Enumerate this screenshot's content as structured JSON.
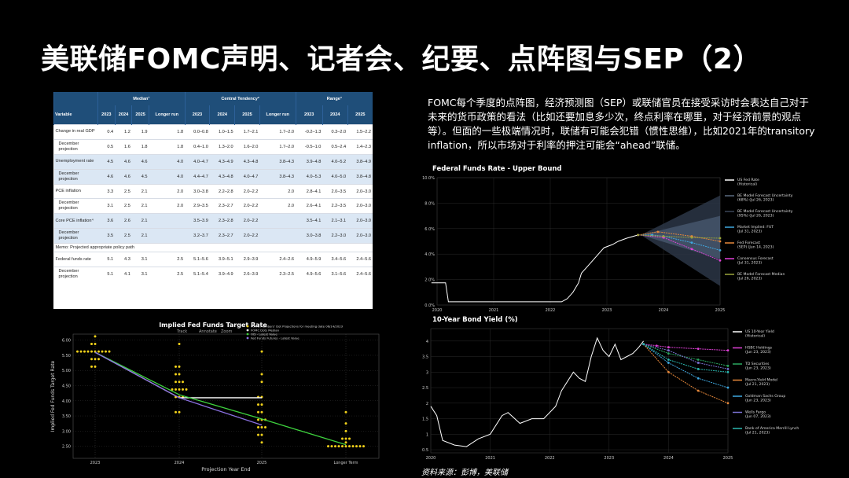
{
  "slide": {
    "title": "美联储FOMC声明、记者会、纪要、点阵图与SEP（2）",
    "commentary": "FOMC每个季度的点阵图，经济预测图（SEP）或联储官员在接受采访时会表达自己对于未来的货币政策的看法（比如还要加息多少次，终点利率在哪里，对于经济前景的观点等）。但面的一些极端情况时，联储有可能会犯错（惯性思维），比如2021年的transitory inflation，所以市场对于利率的押注可能会“ahead”联储。",
    "source": "资料来源：彭博，美联储"
  },
  "sep_table": {
    "variable_header": "Variable",
    "groups": [
      "Median¹",
      "Central Tendency²",
      "Range³"
    ],
    "col_headers": [
      "2023",
      "2024",
      "2025",
      "Longer run",
      "2023",
      "2024",
      "2025",
      "Longer run",
      "2023",
      "2024",
      "2025"
    ],
    "memo": "Memo: Projected appropriate policy path",
    "rows": [
      {
        "label": "Change in real GDP",
        "indent": false,
        "shade": false,
        "cells": [
          "0.4",
          "1.2",
          "1.9",
          "1.8",
          "0.0–0.8",
          "1.0–1.5",
          "1.7–2.1",
          "1.7–2.0",
          "-0.2–1.3",
          "0.3–2.0",
          "1.5–2.2"
        ]
      },
      {
        "label": "December projection",
        "indent": true,
        "shade": false,
        "cells": [
          "0.5",
          "1.6",
          "1.8",
          "1.8",
          "0.4–1.0",
          "1.3–2.0",
          "1.6–2.0",
          "1.7–2.0",
          "-0.5–1.0",
          "0.5–2.4",
          "1.4–2.3"
        ]
      },
      {
        "label": "Unemployment rate",
        "indent": false,
        "shade": true,
        "cells": [
          "4.5",
          "4.6",
          "4.6",
          "4.0",
          "4.0–4.7",
          "4.3–4.9",
          "4.3–4.8",
          "3.8–4.3",
          "3.9–4.8",
          "4.0–5.2",
          "3.8–4.9"
        ]
      },
      {
        "label": "December projection",
        "indent": true,
        "shade": true,
        "cells": [
          "4.6",
          "4.6",
          "4.5",
          "4.0",
          "4.4–4.7",
          "4.3–4.8",
          "4.0–4.7",
          "3.8–4.3",
          "4.0–5.3",
          "4.0–5.0",
          "3.8–4.8"
        ]
      },
      {
        "label": "PCE inflation",
        "indent": false,
        "shade": false,
        "cells": [
          "3.3",
          "2.5",
          "2.1",
          "2.0",
          "3.0–3.8",
          "2.2–2.8",
          "2.0–2.2",
          "2.0",
          "2.8–4.1",
          "2.0–3.5",
          "2.0–3.0"
        ]
      },
      {
        "label": "December projection",
        "indent": true,
        "shade": false,
        "cells": [
          "3.1",
          "2.5",
          "2.1",
          "2.0",
          "2.9–3.5",
          "2.3–2.7",
          "2.0–2.2",
          "2.0",
          "2.6–4.1",
          "2.2–3.5",
          "2.0–3.0"
        ]
      },
      {
        "label": "Core PCE inflation⁴",
        "indent": false,
        "shade": true,
        "cells": [
          "3.6",
          "2.6",
          "2.1",
          "",
          "3.5–3.9",
          "2.3–2.8",
          "2.0–2.2",
          "",
          "3.5–4.1",
          "2.1–3.1",
          "2.0–3.0"
        ]
      },
      {
        "label": "December projection",
        "indent": true,
        "shade": true,
        "cells": [
          "3.5",
          "2.5",
          "2.1",
          "",
          "3.2–3.7",
          "2.3–2.7",
          "2.0–2.2",
          "",
          "3.0–3.8",
          "2.2–3.0",
          "2.0–3.0"
        ]
      },
      {
        "label": "Federal funds rate",
        "indent": false,
        "shade": false,
        "cells": [
          "5.1",
          "4.3",
          "3.1",
          "2.5",
          "5.1–5.6",
          "3.9–5.1",
          "2.9–3.9",
          "2.4–2.6",
          "4.9–5.9",
          "3.4–5.6",
          "2.4–5.6"
        ]
      },
      {
        "label": "December projection",
        "indent": true,
        "shade": false,
        "cells": [
          "5.1",
          "4.1",
          "3.1",
          "2.5",
          "5.1–5.4",
          "3.9–4.9",
          "2.6–3.9",
          "2.3–2.5",
          "4.9–5.6",
          "3.1–5.6",
          "2.4–5.6"
        ]
      }
    ]
  },
  "dot_plot": {
    "title": "Implied Fed Funds Target Rate",
    "toolbar": [
      "Track",
      "Annotate",
      "Zoom"
    ],
    "legend": [
      "FOMC Members' Dot Projections for meeting date 06/14/2023",
      "FOMC Dots Median",
      "OIS - Latest Value",
      "Fed Funds Futures - Latest Value"
    ],
    "xlabel": "Projection Year End",
    "ylabel": "Implied Fed Funds Target Rate",
    "colors": {
      "dots": "#f2d21a",
      "median": "#ffffff",
      "ois": "#3ed23e",
      "futures": "#8a70e0"
    }
  },
  "chart_data": [
    {
      "type": "scatter",
      "title": "Implied Fed Funds Target Rate",
      "xlabel": "Projection Year End",
      "ylabel": "Implied Fed Funds Target Rate",
      "categories": [
        "2023",
        "2024",
        "2025",
        "Longer Term"
      ],
      "ylim": [
        2.1,
        6.2
      ],
      "yticks": [
        "6.00",
        "5.50",
        "5.00",
        "4.50",
        "4.00",
        "3.50",
        "3.00",
        "2.50"
      ],
      "dots": [
        [
          5.625,
          5.625,
          5.625,
          5.625,
          5.625,
          5.625,
          5.625,
          5.625,
          5.625,
          5.375,
          5.375,
          5.375,
          5.875,
          5.875,
          5.125,
          5.125,
          6.125,
          5.625
        ],
        [
          5.125,
          4.625,
          4.375,
          4.375,
          4.375,
          4.375,
          4.375,
          4.625,
          4.875,
          4.875,
          4.125,
          4.125,
          3.625,
          3.625,
          4.125,
          5.125,
          5.875,
          4.625
        ],
        [
          3.625,
          3.375,
          3.375,
          3.125,
          3.125,
          3.125,
          2.875,
          2.875,
          3.375,
          3.875,
          3.875,
          4.125,
          4.125,
          4.625,
          5.625,
          4.875,
          2.625,
          3.625
        ],
        [
          2.5,
          2.5,
          2.5,
          2.5,
          2.5,
          2.5,
          2.5,
          2.5,
          2.5,
          2.5,
          2.5,
          2.625,
          2.75,
          2.75,
          3.0,
          3.25,
          3.625,
          2.75
        ]
      ],
      "series": [
        {
          "name": "FOMC Dots Median",
          "values": [
            5.6,
            4.1,
            4.1,
            null
          ]
        },
        {
          "name": "OIS - Latest Value",
          "values": [
            5.6,
            4.2,
            3.4,
            2.55
          ]
        },
        {
          "name": "Fed Funds Futures - Latest Value",
          "values": [
            5.6,
            4.1,
            3.2,
            null
          ]
        }
      ]
    },
    {
      "type": "line",
      "title": "Federal Funds Rate - Upper Bound",
      "x_ticks": [
        "2020",
        "2021",
        "2022",
        "2023",
        "2024",
        "2025"
      ],
      "y_ticks": [
        "10.0%",
        "8.0%",
        "6.0%",
        "4.0%",
        "2.0%",
        "0.0%"
      ],
      "ylim": [
        0,
        10
      ],
      "legend": [
        {
          "name": "US Fed Rate (Historical)",
          "color": "#ffffff"
        },
        {
          "name": "BE Model Forecast Uncertainty (68%) (Jul 26, 2023)",
          "color": "#5a6a80"
        },
        {
          "name": "BE Model Forecast Uncertainty (95%) (Jul 26, 2023)",
          "color": "#3a4658"
        },
        {
          "name": "Market Implied: FUT (Jul 31, 2023)",
          "color": "#3fa8e0"
        },
        {
          "name": "Fed Forecast (SEP) (Jun 14, 2023)",
          "color": "#e6883a"
        },
        {
          "name": "Consensus Forecast (Jul 31, 2023)",
          "color": "#e040d8"
        },
        {
          "name": "BE Model Forecast Median (Jul 26, 2023)",
          "color": "#9aa63a"
        }
      ],
      "historical": [
        [
          2019.9,
          1.75
        ],
        [
          2020.15,
          1.75
        ],
        [
          2020.2,
          0.25
        ],
        [
          2022.2,
          0.25
        ],
        [
          2022.3,
          0.5
        ],
        [
          2022.4,
          1.0
        ],
        [
          2022.5,
          1.75
        ],
        [
          2022.55,
          2.5
        ],
        [
          2022.7,
          3.25
        ],
        [
          2022.85,
          4.0
        ],
        [
          2022.95,
          4.5
        ],
        [
          2023.1,
          4.75
        ],
        [
          2023.2,
          5.0
        ],
        [
          2023.35,
          5.25
        ],
        [
          2023.55,
          5.5
        ]
      ],
      "forecasts": [
        {
          "name": "Market Implied: FUT",
          "values": [
            [
              2023.55,
              5.5
            ],
            [
              2023.8,
              5.5
            ],
            [
              2024.0,
              5.4
            ],
            [
              2024.5,
              4.9
            ],
            [
              2025.0,
              4.3
            ]
          ]
        },
        {
          "name": "Fed Forecast (SEP)",
          "values": [
            [
              2023.55,
              5.5
            ],
            [
              2023.9,
              5.75
            ],
            [
              2024.5,
              5.4
            ],
            [
              2025.0,
              5.0
            ]
          ]
        },
        {
          "name": "Consensus Forecast",
          "values": [
            [
              2023.55,
              5.5
            ],
            [
              2024.0,
              5.3
            ],
            [
              2024.5,
              4.4
            ],
            [
              2025.0,
              3.5
            ]
          ]
        },
        {
          "name": "BE Model Forecast Median",
          "values": [
            [
              2023.55,
              5.5
            ],
            [
              2024.0,
              5.4
            ],
            [
              2024.5,
              5.3
            ],
            [
              2025.0,
              5.25
            ]
          ]
        }
      ]
    },
    {
      "type": "line",
      "title": "10-Year Bond Yield (%)",
      "x_ticks": [
        "2020",
        "2021",
        "2022",
        "2023",
        "2024",
        "2025"
      ],
      "y_ticks": [
        "4",
        "3.5",
        "3",
        "2.5",
        "2",
        "1.5",
        "1",
        "0.5"
      ],
      "ylim": [
        0.4,
        4.4
      ],
      "legend": [
        {
          "name": "US 10-Year Yield (Historical)",
          "color": "#ffffff"
        },
        {
          "name": "HSBC Holdings (Jun 23, 2023)",
          "color": "#e040d8"
        },
        {
          "name": "TD Securities (Jun 23, 2023)",
          "color": "#2aa860"
        },
        {
          "name": "Macro-Yield Model (Jul 21, 2023)",
          "color": "#e6883a"
        },
        {
          "name": "Goldman Sachs Group (Jun 23, 2023)",
          "color": "#3fa8e0"
        },
        {
          "name": "Wells Fargo (Jun 07, 2023)",
          "color": "#7a70d0"
        },
        {
          "name": "Bank of America Merrill Lynch (Jul 21, 2023)",
          "color": "#2ab8b0"
        }
      ],
      "historical": [
        [
          2020.0,
          1.9
        ],
        [
          2020.1,
          1.6
        ],
        [
          2020.2,
          0.8
        ],
        [
          2020.4,
          0.65
        ],
        [
          2020.6,
          0.6
        ],
        [
          2020.8,
          0.85
        ],
        [
          2021.0,
          1.0
        ],
        [
          2021.2,
          1.6
        ],
        [
          2021.3,
          1.7
        ],
        [
          2021.5,
          1.35
        ],
        [
          2021.7,
          1.5
        ],
        [
          2021.9,
          1.5
        ],
        [
          2022.1,
          1.9
        ],
        [
          2022.2,
          2.4
        ],
        [
          2022.4,
          3.0
        ],
        [
          2022.5,
          2.8
        ],
        [
          2022.6,
          2.7
        ],
        [
          2022.7,
          3.5
        ],
        [
          2022.8,
          4.1
        ],
        [
          2022.9,
          3.7
        ],
        [
          2023.0,
          3.5
        ],
        [
          2023.1,
          3.9
        ],
        [
          2023.2,
          3.4
        ],
        [
          2023.4,
          3.6
        ],
        [
          2023.5,
          3.8
        ],
        [
          2023.58,
          4.0
        ]
      ],
      "forecasts": [
        {
          "name": "HSBC Holdings",
          "values": [
            [
              2023.58,
              3.9
            ],
            [
              2023.8,
              3.85
            ],
            [
              2024.0,
              3.8
            ],
            [
              2024.5,
              3.75
            ],
            [
              2025.0,
              3.7
            ]
          ]
        },
        {
          "name": "TD Securities",
          "values": [
            [
              2023.58,
              3.9
            ],
            [
              2024.0,
              3.6
            ],
            [
              2024.5,
              3.4
            ],
            [
              2025.0,
              3.2
            ]
          ]
        },
        {
          "name": "Macro-Yield Model",
          "values": [
            [
              2023.58,
              3.9
            ],
            [
              2024.0,
              3.0
            ],
            [
              2024.5,
              2.4
            ],
            [
              2025.0,
              2.0
            ]
          ]
        },
        {
          "name": "Goldman Sachs Group",
          "values": [
            [
              2023.58,
              3.9
            ],
            [
              2024.0,
              3.3
            ],
            [
              2024.5,
              2.8
            ],
            [
              2025.0,
              2.5
            ]
          ]
        },
        {
          "name": "Wells Fargo",
          "values": [
            [
              2023.58,
              3.9
            ],
            [
              2024.0,
              3.7
            ],
            [
              2024.5,
              3.3
            ],
            [
              2025.0,
              3.1
            ]
          ]
        },
        {
          "name": "Bank of America Merrill Lynch",
          "values": [
            [
              2023.58,
              3.9
            ],
            [
              2024.0,
              3.4
            ],
            [
              2024.5,
              3.1
            ],
            [
              2025.0,
              3.0
            ]
          ]
        }
      ]
    }
  ]
}
